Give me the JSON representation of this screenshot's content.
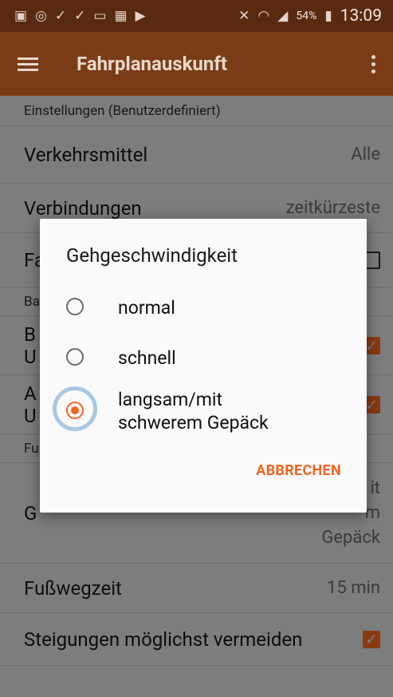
{
  "status_bar": {
    "left_icons": [
      "image-icon",
      "voicemail-circle-icon",
      "download-done-icon",
      "download-done-icon",
      "voicemail-icon",
      "battery-saver-icon",
      "cast-icon"
    ],
    "battery": "54%",
    "time": "13:09"
  },
  "app_bar": {
    "title": "Fahrplanauskunft"
  },
  "settings": {
    "header": "Einstellungen (Benutzerdefiniert)",
    "transport_label": "Verkehrsmittel",
    "transport_value": "Alle",
    "connections_label": "Verbindungen",
    "connections_value": "zeitkürzeste",
    "fa_partial": "Fa",
    "ba_partial": "Ba",
    "b_partial": "B",
    "u_partial_1": "U",
    "a_partial": "A",
    "u_partial_2": "U",
    "fu_partial": "Fu",
    "g_partial": "G",
    "right_it": "it",
    "right_m": "m",
    "right_gepaeck": "Gepäck",
    "walk_time_label": "Fußwegzeit",
    "walk_time_value": "15 min",
    "slopes_label": "Steigungen möglichst vermeiden",
    "slopes_checked": "✓"
  },
  "dialog": {
    "title": "Gehgeschwindigkeit",
    "options": [
      {
        "label_1": "normal",
        "label_2": ""
      },
      {
        "label_1": "schnell",
        "label_2": ""
      },
      {
        "label_1": "langsam/mit",
        "label_2": "schwerem Gepäck"
      }
    ],
    "selected_index": 2,
    "cancel": "ABBRECHEN"
  },
  "colors": {
    "accent": "#f26522",
    "app_bar": "#7a3c17",
    "status_bar": "#5a2a10",
    "dim_background": "#7d7d7d"
  }
}
